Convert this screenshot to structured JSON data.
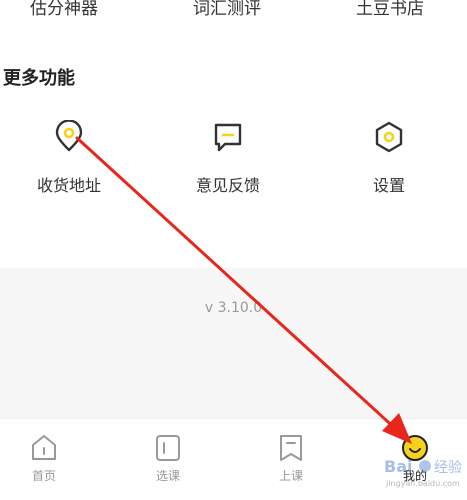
{
  "top_tools": [
    "估分神器",
    "词汇测评",
    "土豆书店"
  ],
  "more_features": {
    "title": "更多功能",
    "items": [
      {
        "label": "收货地址",
        "icon": "location-pin-icon"
      },
      {
        "label": "意见反馈",
        "icon": "feedback-chat-icon"
      },
      {
        "label": "设置",
        "icon": "settings-hexagon-icon"
      }
    ]
  },
  "version": "v 3.10.0",
  "tabbar": {
    "items": [
      {
        "label": "首页",
        "icon": "home-icon"
      },
      {
        "label": "选课",
        "icon": "course-select-icon"
      },
      {
        "label": "上课",
        "icon": "bookmark-icon"
      },
      {
        "label": "我的",
        "icon": "smiley-profile-icon",
        "active": true
      }
    ]
  },
  "colors": {
    "accent_yellow": "#f7d21d",
    "arrow_red": "#e8261c",
    "icon_dark": "#333333",
    "tab_inactive": "#999999",
    "version_bg": "#f7f7f7"
  }
}
